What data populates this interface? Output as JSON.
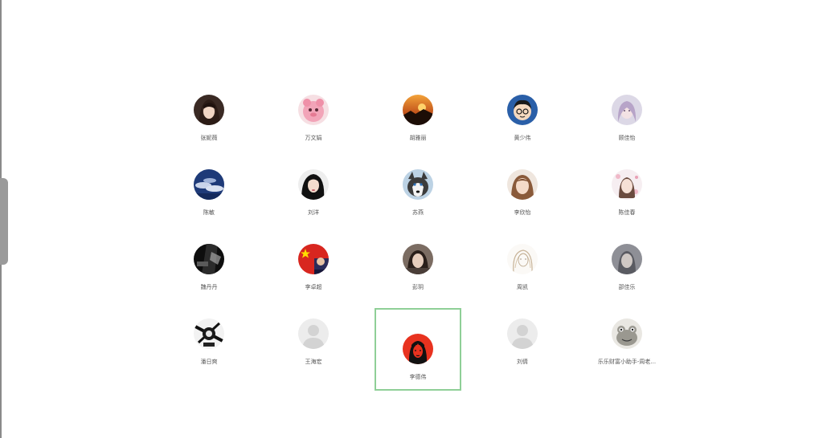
{
  "contacts": [
    {
      "name": "张妮薇",
      "avatar": "girl-dark-hair"
    },
    {
      "name": "万文娟",
      "avatar": "pink-cartoon"
    },
    {
      "name": "胡雅丽",
      "avatar": "sunset"
    },
    {
      "name": "黄少伟",
      "avatar": "boy-glasses-cartoon"
    },
    {
      "name": "顾佳怡",
      "avatar": "girl-pastel"
    },
    {
      "name": "陈敏",
      "avatar": "sky-clouds"
    },
    {
      "name": "刘洋",
      "avatar": "girl-black-hair"
    },
    {
      "name": "苏燕",
      "avatar": "husky-dog"
    },
    {
      "name": "李欣怡",
      "avatar": "girl-brown-hair"
    },
    {
      "name": "陈佳春",
      "avatar": "girl-flowers"
    },
    {
      "name": "魏丹丹",
      "avatar": "dark-scene"
    },
    {
      "name": "李卓超",
      "avatar": "china-flag"
    },
    {
      "name": "彭玥",
      "avatar": "girl-photo"
    },
    {
      "name": "周凯",
      "avatar": "sketch-girl"
    },
    {
      "name": "邵佳乐",
      "avatar": "grey-portrait"
    },
    {
      "name": "潘日爽",
      "avatar": "bw-graphic"
    },
    {
      "name": "王海宏",
      "avatar": "default-user"
    },
    {
      "name": "李德伟",
      "avatar": "che-guevara-red"
    },
    {
      "name": "刘倩",
      "avatar": "default-user"
    },
    {
      "name": "乐乐财富小助手-周老...",
      "avatar": "cartoon-frog"
    }
  ],
  "selected_index": 17,
  "colors": {
    "selection_border": "#8fcf97",
    "label": "#555555"
  }
}
